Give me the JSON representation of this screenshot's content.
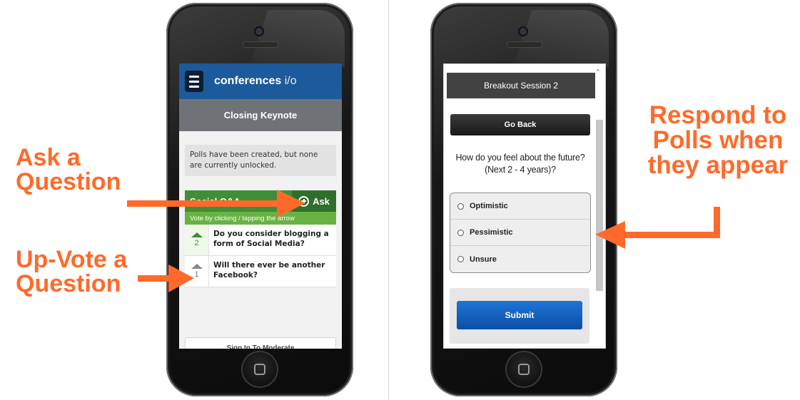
{
  "annotations": {
    "ask": [
      "Ask a",
      "Question"
    ],
    "upvote": [
      "Up-Vote a",
      "Question"
    ],
    "respond": [
      "Respond to",
      "Polls when",
      "they appear"
    ]
  },
  "left_screen": {
    "brand_bold": "conferences",
    "brand_light": " i/o",
    "session_title": "Closing Keynote",
    "poll_note": "Polls have been created, but none are currently unlocked.",
    "qa_title": "Social Q&A",
    "ask_label": "Ask",
    "vote_hint": "Vote by clicking / tapping the arrow",
    "questions": [
      {
        "votes": "2",
        "text": "Do you consider blogging a form of Social Media?"
      },
      {
        "votes": "1",
        "text": "Will there ever be another Facebook?"
      }
    ],
    "sign_in": "Sign In To Moderate"
  },
  "right_screen": {
    "session_title": "Breakout Session 2",
    "go_back": "Go Back",
    "question": "How do you feel about the future? (Next 2 - 4 years)?",
    "options": [
      "Optimistic",
      "Pessimistic",
      "Unsure"
    ],
    "submit": "Submit"
  },
  "colors": {
    "annotation": "#ff6a2b",
    "topbar": "#1c5a9b",
    "qa_green": "#3e8e3a",
    "submit_blue": "#1e74d6"
  }
}
